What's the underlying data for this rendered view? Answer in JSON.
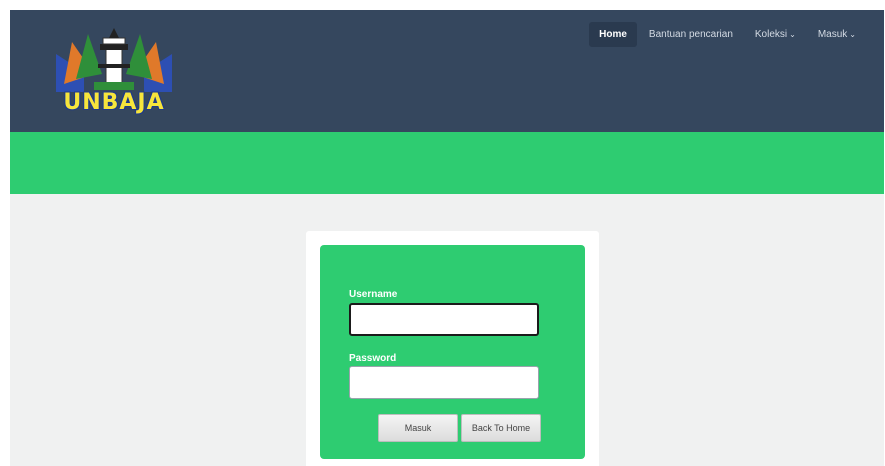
{
  "logo": {
    "text": "UNBAJA"
  },
  "nav": {
    "items": [
      {
        "label": "Home",
        "active": true,
        "has_caret": false
      },
      {
        "label": "Bantuan pencarian",
        "active": false,
        "has_caret": false
      },
      {
        "label": "Koleksi",
        "active": false,
        "has_caret": true
      },
      {
        "label": "Masuk",
        "active": false,
        "has_caret": true
      }
    ]
  },
  "login": {
    "username_label": "Username",
    "username_value": "",
    "password_label": "Password",
    "password_value": "",
    "submit_label": "Masuk",
    "back_label": "Back To Home"
  },
  "colors": {
    "navbar": "#35475e",
    "accent_green": "#2ecc71",
    "logo_yellow": "#f7e53c"
  }
}
